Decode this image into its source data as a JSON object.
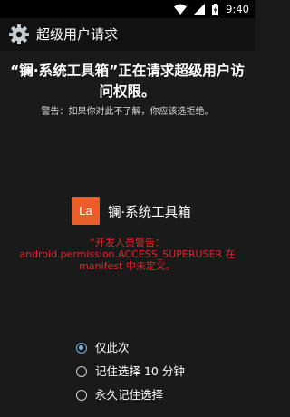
{
  "status_bar": {
    "time": "9:40",
    "icons": [
      "wifi-icon",
      "signal-icon",
      "battery-charging-icon"
    ]
  },
  "action_bar": {
    "icon": "gear-icon",
    "title": "超级用户请求"
  },
  "request": {
    "headline": "“镧·系统工具箱”正在请求超级用户访问权限。",
    "warning": "警告：如果你对此不了解，你应该选拒绝。"
  },
  "package": {
    "icon_text": "La",
    "icon_color": "#ea5d28",
    "name": "镧·系统工具箱"
  },
  "developer_warning": "“开发人员警告：android.permission.ACCESS_SUPERUSER 在 manifest 中未定义。",
  "options": [
    {
      "label": "仅此次",
      "checked": true
    },
    {
      "label": "记住选择 10 分钟",
      "checked": false
    },
    {
      "label": "永久记住选择",
      "checked": false
    }
  ],
  "colors": {
    "accent": "#7ab4e2",
    "warning_red": "#d9272e",
    "background": "#1a1a1a"
  }
}
